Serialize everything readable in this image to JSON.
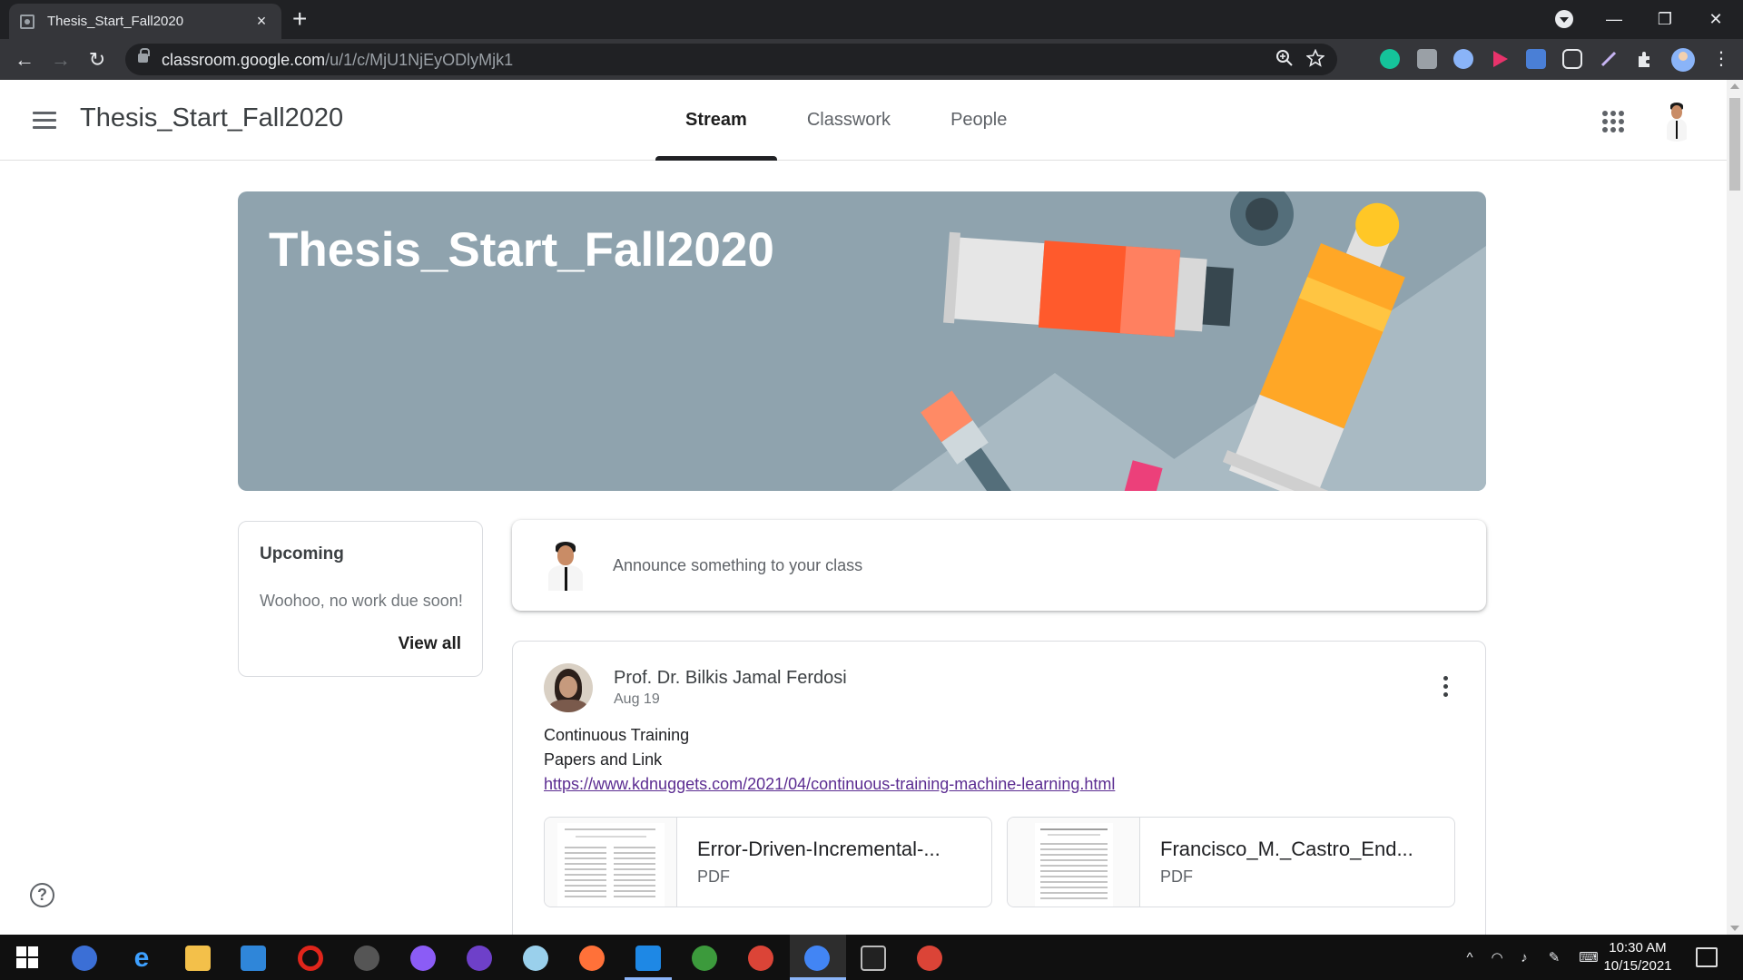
{
  "browser": {
    "tab_title": "Thesis_Start_Fall2020",
    "tab_close": "×",
    "new_tab": "+",
    "url_host": "classroom.google.com",
    "url_path": "/u/1/c/MjU1NjEyODlyMjk1",
    "window_controls": {
      "minimize": "—",
      "restore": "❐",
      "close": "✕"
    }
  },
  "header": {
    "class_title": "Thesis_Start_Fall2020",
    "tabs": [
      {
        "label": "Stream",
        "active": true
      },
      {
        "label": "Classwork",
        "active": false
      },
      {
        "label": "People",
        "active": false
      }
    ]
  },
  "banner": {
    "title": "Thesis_Start_Fall2020"
  },
  "upcoming": {
    "heading": "Upcoming",
    "message": "Woohoo, no work due soon!",
    "view_all": "View all"
  },
  "announce": {
    "placeholder": "Announce something to your class"
  },
  "post": {
    "author": "Prof. Dr. Bilkis Jamal Ferdosi",
    "date": "Aug 19",
    "lines": [
      "Continuous Training",
      "Papers and Link"
    ],
    "link": "https://www.kdnuggets.com/2021/04/continuous-training-machine-learning.html",
    "attachments": [
      {
        "name": "Error-Driven-Incremental-...",
        "type": "PDF"
      },
      {
        "name": "Francisco_M._Castro_End...",
        "type": "PDF"
      }
    ]
  },
  "help": "?",
  "taskbar": {
    "time": "10:30 AM",
    "date": "10/15/2021"
  },
  "colors": {
    "banner_bg": "#8fa3ae",
    "active_tab_indicator": "#202124",
    "link": "#5b2c91",
    "chrome_dark": "#202124"
  }
}
